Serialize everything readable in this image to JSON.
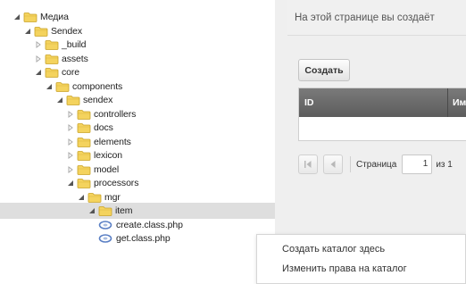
{
  "tree": {
    "nodes": [
      {
        "label": "Медиа",
        "kind": "folder",
        "expanded": true,
        "level": 0
      },
      {
        "label": "Sendex",
        "kind": "folder",
        "expanded": true,
        "level": 1
      },
      {
        "label": "_build",
        "kind": "folder",
        "expanded": false,
        "level": 2
      },
      {
        "label": "assets",
        "kind": "folder",
        "expanded": false,
        "level": 2
      },
      {
        "label": "core",
        "kind": "folder",
        "expanded": true,
        "level": 2
      },
      {
        "label": "components",
        "kind": "folder",
        "expanded": true,
        "level": 3
      },
      {
        "label": "sendex",
        "kind": "folder",
        "expanded": true,
        "level": 4
      },
      {
        "label": "controllers",
        "kind": "folder",
        "expanded": false,
        "level": 5
      },
      {
        "label": "docs",
        "kind": "folder",
        "expanded": false,
        "level": 5
      },
      {
        "label": "elements",
        "kind": "folder",
        "expanded": false,
        "level": 5
      },
      {
        "label": "lexicon",
        "kind": "folder",
        "expanded": false,
        "level": 5
      },
      {
        "label": "model",
        "kind": "folder",
        "expanded": false,
        "level": 5
      },
      {
        "label": "processors",
        "kind": "folder",
        "expanded": true,
        "level": 5
      },
      {
        "label": "mgr",
        "kind": "folder",
        "expanded": true,
        "level": 6
      },
      {
        "label": "item",
        "kind": "folder",
        "expanded": true,
        "level": 7,
        "selected": true
      },
      {
        "label": "create.class.php",
        "kind": "file",
        "level": 8
      },
      {
        "label": "get.class.php",
        "kind": "file",
        "level": 8
      }
    ]
  },
  "main": {
    "description": "На этой странице вы создаёт",
    "create_button": "Создать",
    "grid": {
      "columns": [
        "ID",
        "Им"
      ]
    },
    "pager": {
      "page_label": "Страница",
      "page_value": "1",
      "of_label": "из 1"
    }
  },
  "context_menu": {
    "items": [
      "Создать каталог здесь",
      "Изменить права на каталог"
    ]
  },
  "colors": {
    "folder_fill": "#f4d35e",
    "folder_stroke": "#c9a227",
    "grid_header": "#6a6a6a",
    "selected_row": "#dedede",
    "file_icon": "#5a7fc4"
  }
}
